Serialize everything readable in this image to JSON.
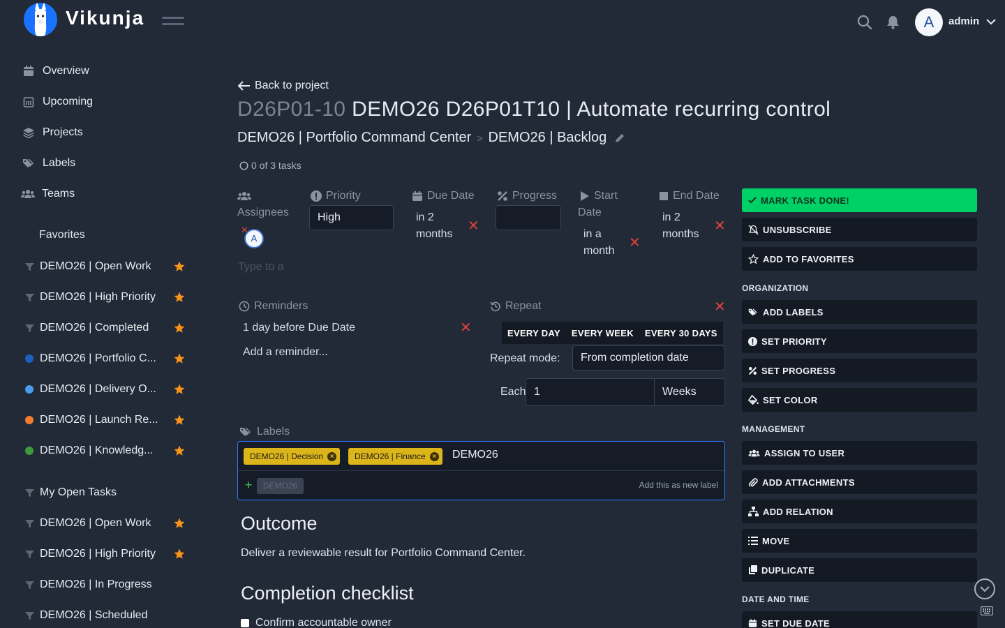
{
  "app": {
    "name": "Vikunja",
    "user_initial": "A",
    "username": "admin"
  },
  "sidebar": {
    "nav": [
      {
        "label": "Overview",
        "icon": "calendar-icon"
      },
      {
        "label": "Upcoming",
        "icon": "calendar-grid-icon"
      },
      {
        "label": "Projects",
        "icon": "layers-icon"
      },
      {
        "label": "Labels",
        "icon": "tags-icon"
      },
      {
        "label": "Teams",
        "icon": "users-icon"
      }
    ],
    "favorites_heading": "Favorites",
    "favorites": [
      {
        "label": "DEMO26 | Open Work",
        "kind": "filter"
      },
      {
        "label": "DEMO26 | High Priority",
        "kind": "filter"
      },
      {
        "label": "DEMO26 | Completed",
        "kind": "filter"
      },
      {
        "label": "DEMO26 | Portfolio C...",
        "kind": "project",
        "color": "#1f5fbf"
      },
      {
        "label": "DEMO26 | Delivery O...",
        "kind": "project",
        "color": "#4b9bef"
      },
      {
        "label": "DEMO26 | Launch Re...",
        "kind": "project",
        "color": "#f07d2e"
      },
      {
        "label": "DEMO26 | Knowledg...",
        "kind": "project",
        "color": "#3f9a3a"
      }
    ],
    "saved_filters": [
      {
        "label": "My Open Tasks",
        "starred": false
      },
      {
        "label": "DEMO26 | Open Work",
        "starred": true
      },
      {
        "label": "DEMO26 | High Priority",
        "starred": true
      },
      {
        "label": "DEMO26 | In Progress",
        "starred": false
      },
      {
        "label": "DEMO26 | Scheduled",
        "starred": false
      }
    ]
  },
  "task": {
    "back_label": "Back to project",
    "identifier": "D26P01-10",
    "title": "DEMO26 D26P01T10 | Automate recurring control",
    "breadcrumb": [
      "DEMO26 | Portfolio Command Center",
      "DEMO26 | Backlog"
    ],
    "breadcrumb_sep": ">",
    "subtasks": "0 of 3 tasks",
    "assignees_label": "Assignees",
    "assignee_initial": "A",
    "assignee_placeholder": "Type to a",
    "priority_label": "Priority",
    "priority_value": "High",
    "due_label": "Due Date",
    "due_value_1": "in 2",
    "due_value_2": "months",
    "progress_label": "Progress",
    "progress_value": "",
    "start_label_1": "Start",
    "start_label_2": "Date",
    "start_value_1": "in a",
    "start_value_2": "month",
    "end_label": "End Date",
    "end_value_1": "in 2",
    "end_value_2": "months",
    "remove_glyph": "✕",
    "reminders_label": "Reminders",
    "reminder_item": "1 day before Due Date",
    "add_reminder": "Add a reminder...",
    "repeat_label": "Repeat",
    "repeat_options": [
      "EVERY DAY",
      "EVERY WEEK",
      "EVERY 30 DAYS"
    ],
    "repeat_mode_label": "Repeat mode:",
    "repeat_mode_value": "From completion date",
    "each_label": "Each",
    "each_value": "1",
    "each_unit": "Weeks",
    "labels_label": "Labels",
    "labels": [
      "DEMO26 | Decision",
      "DEMO26 | Finance"
    ],
    "label_remove_glyph": "×",
    "label_input": "DEMO26",
    "label_suggestion": "DEMO26",
    "label_add_hint": "Add this as new label",
    "label_add_glyph": "+",
    "outcome_heading": "Outcome",
    "outcome_text": "Deliver a reviewable result for Portfolio Command Center.",
    "checklist_heading": "Completion checklist",
    "checklist_first": "Confirm accountable owner"
  },
  "actions": {
    "mark_done": "MARK TASK DONE!",
    "unsubscribe": "UNSUBSCRIBE",
    "add_favorites": "ADD TO FAVORITES",
    "organization_heading": "ORGANIZATION",
    "add_labels": "ADD LABELS",
    "set_priority": "SET PRIORITY",
    "set_progress": "SET PROGRESS",
    "set_color": "SET COLOR",
    "management_heading": "MANAGEMENT",
    "assign_user": "ASSIGN TO USER",
    "add_attachments": "ADD ATTACHMENTS",
    "add_relation": "ADD RELATION",
    "move": "MOVE",
    "duplicate": "DUPLICATE",
    "datetime_heading": "DATE AND TIME",
    "set_due_date": "SET DUE DATE"
  },
  "colors": {
    "background": "#222a38",
    "accent": "#1973ff",
    "done": "#00d166",
    "star": "#f7931a",
    "danger": "#e0413c",
    "label_tag": "#dcb51a"
  }
}
